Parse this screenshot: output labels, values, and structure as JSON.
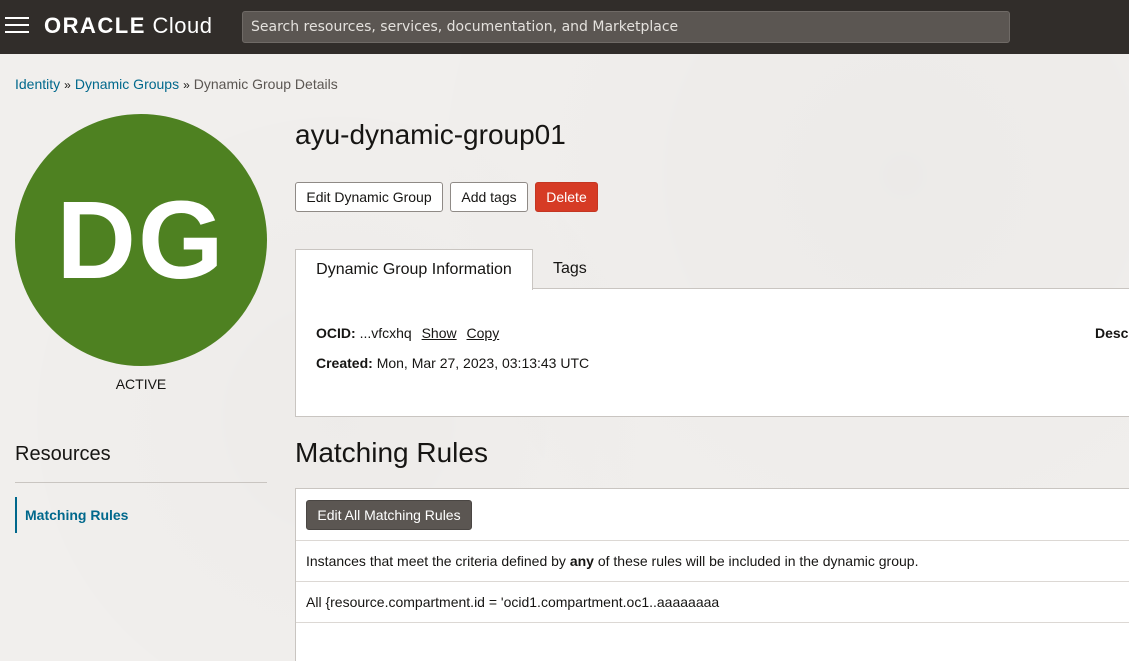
{
  "topbar": {
    "brand": "ORACLE",
    "product": "Cloud",
    "search_placeholder": "Search resources, services, documentation, and Marketplace"
  },
  "breadcrumb": {
    "items": [
      "Identity",
      "Dynamic Groups"
    ],
    "current": "Dynamic Group Details",
    "separator": "»"
  },
  "avatar": {
    "initials": "DG",
    "color": "#4e8121",
    "status": "ACTIVE"
  },
  "resources": {
    "title": "Resources",
    "items": [
      "Matching Rules"
    ]
  },
  "page": {
    "title": "ayu-dynamic-group01",
    "buttons": {
      "edit": "Edit Dynamic Group",
      "add_tags": "Add tags",
      "delete": "Delete"
    },
    "tabs": [
      "Dynamic Group Information",
      "Tags"
    ]
  },
  "info": {
    "ocid_label": "OCID:",
    "ocid_value": "...vfcxhq",
    "show": "Show",
    "copy": "Copy",
    "created_label": "Created:",
    "created_value": "Mon, Mar 27, 2023, 03:13:43 UTC",
    "description_label": "Desc"
  },
  "matching_rules": {
    "title": "Matching Rules",
    "edit_button": "Edit All Matching Rules",
    "desc_prefix": "Instances that meet the criteria defined by ",
    "desc_bold": "any",
    "desc_suffix": " of these rules will be included in the dynamic group.",
    "rules": [
      "All {resource.compartment.id = 'ocid1.compartment.oc1..aaaaaaaa"
    ]
  },
  "colors": {
    "topbar": "#312d2a",
    "link": "#00688c",
    "danger": "#d63b25",
    "avatar": "#4e8121"
  }
}
